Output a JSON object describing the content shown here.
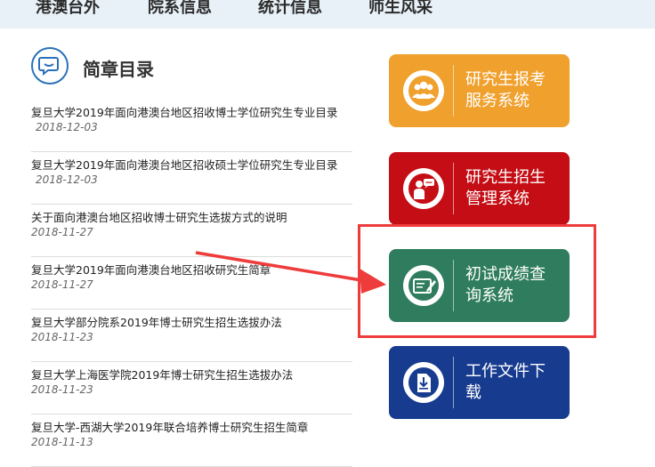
{
  "nav": {
    "items": [
      {
        "label": "港澳台外"
      },
      {
        "label": "院系信息"
      },
      {
        "label": "统计信息"
      },
      {
        "label": "师生风采"
      }
    ]
  },
  "section": {
    "title": "简章目录",
    "icon": "chat-bubble-icon"
  },
  "news": [
    {
      "title": "复旦大学2019年面向港澳台地区招收博士学位研究生专业目录",
      "date": "2018-12-03"
    },
    {
      "title": "复旦大学2019年面向港澳台地区招收硕士学位研究生专业目录",
      "date": "2018-12-03"
    },
    {
      "title": "关于面向港澳台地区招收博士研究生选拔方式的说明",
      "date": "2018-11-27"
    },
    {
      "title": "复旦大学2019年面向港澳台地区招收研究生简章",
      "date": "2018-11-27"
    },
    {
      "title": "复旦大学部分院系2019年博士研究生招生选拔办法",
      "date": "2018-11-23"
    },
    {
      "title": "复旦大学上海医学院2019年博士研究生招生选拔办法",
      "date": "2018-11-23"
    },
    {
      "title": "复旦大学-西湖大学2019年联合培养博士研究生招生简章",
      "date": "2018-11-13"
    }
  ],
  "systems": [
    {
      "line1": "研究生报考",
      "line2": "服务系统",
      "color": "#f0a02c",
      "icon": "users-icon"
    },
    {
      "line1": "研究生招生",
      "line2": "管理系统",
      "color": "#c40d14",
      "icon": "presenter-icon"
    },
    {
      "line1": "初试成绩查",
      "line2": "询系统",
      "color": "#2f7d5e",
      "icon": "edit-certificate-icon"
    },
    {
      "line1": "工作文件下",
      "line2": "载",
      "color": "#173c8f",
      "icon": "document-download-icon"
    }
  ],
  "annotation": {
    "color": "#ee3b3b"
  }
}
